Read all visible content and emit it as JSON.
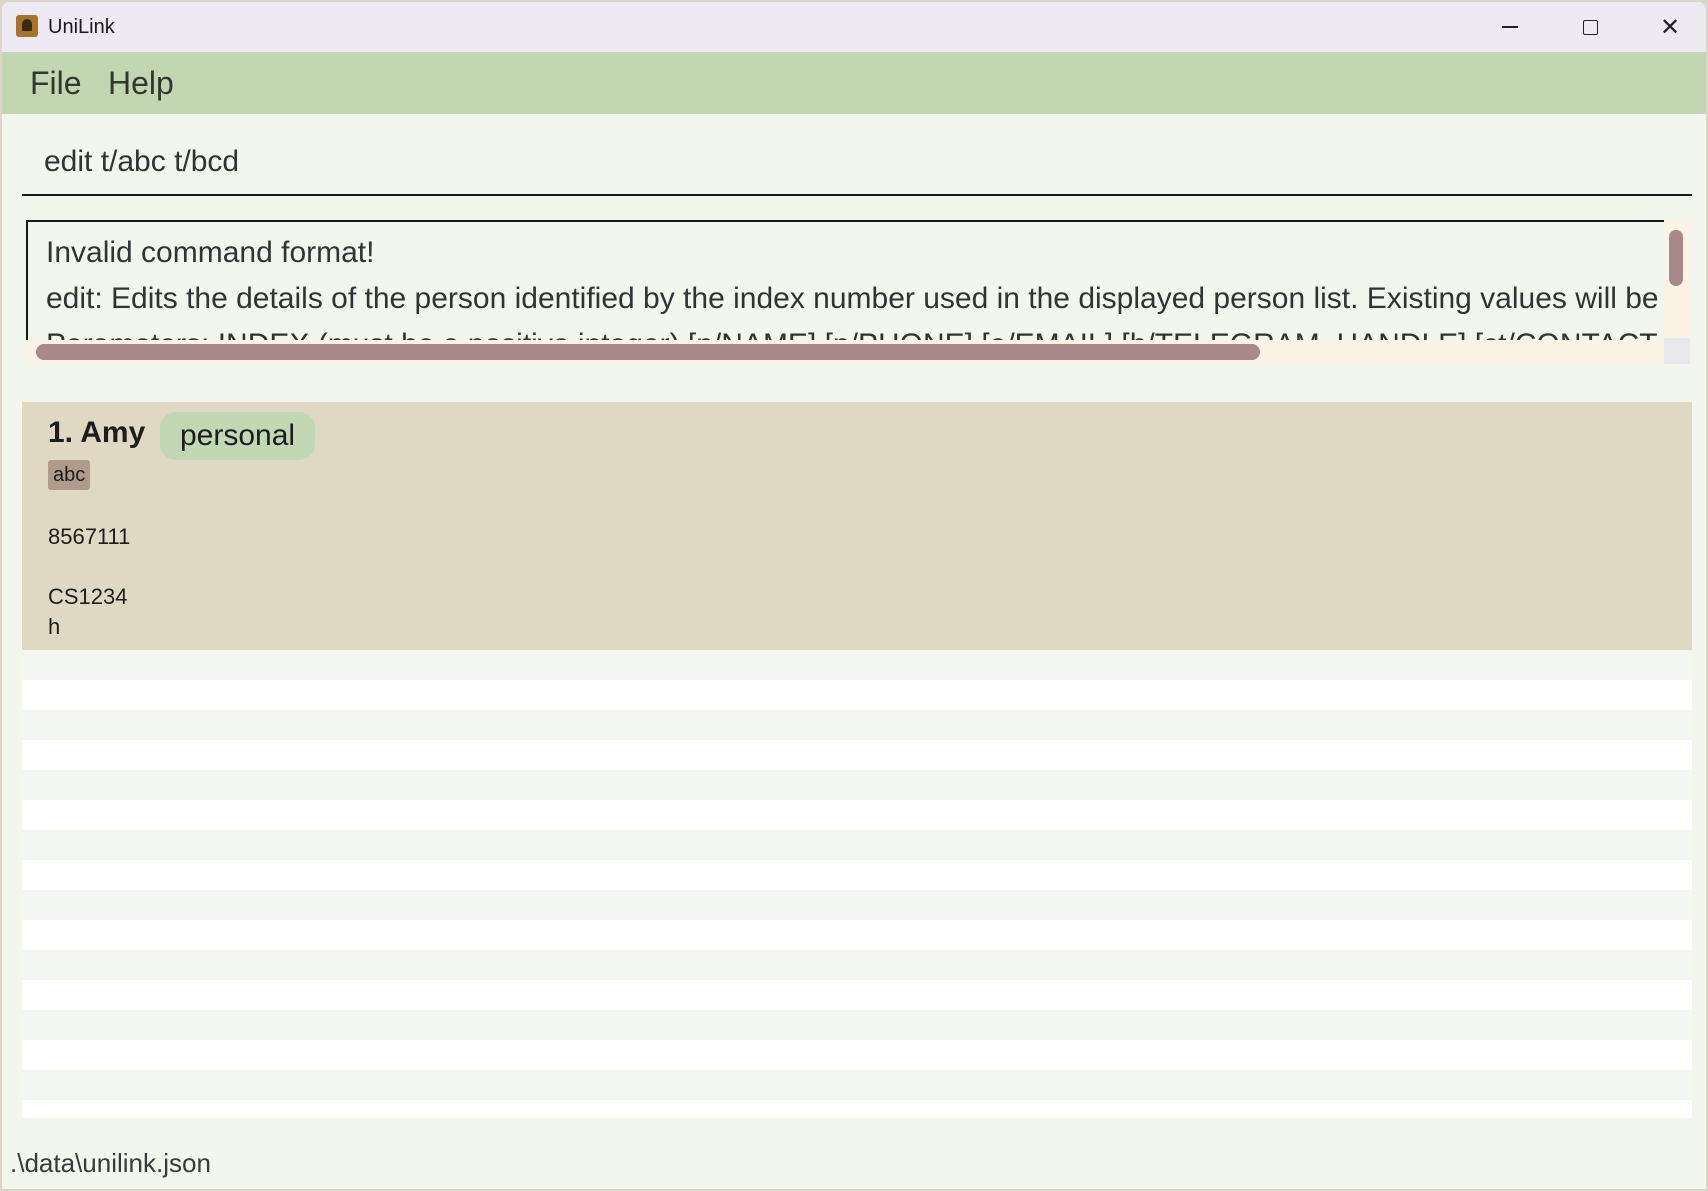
{
  "window": {
    "title": "UniLink",
    "icon": "address-book-icon"
  },
  "menu": {
    "file_label": "File",
    "help_label": "Help"
  },
  "command": {
    "value": "edit t/abc t/bcd"
  },
  "result": {
    "lines": [
      "Invalid command format!",
      "edit: Edits the details of the person identified by the index number used in the displayed person list. Existing values will be overwritten by the input values.",
      "Parameters: INDEX (must be a positive integer) [n/NAME] [p/PHONE] [e/EMAIL] [h/TELEGRAM_HANDLE] [ct/CONTACT_TYPE] [m/MODULE] [t/TAG]..."
    ]
  },
  "persons": [
    {
      "index_name": "1. Amy",
      "contact_type": "personal",
      "tags": [
        "abc"
      ],
      "phone": "8567111",
      "module": "CS1234",
      "handle": "h"
    }
  ],
  "status": {
    "path": ".\\data\\unilink.json"
  },
  "colors": {
    "menubar": "#c2d6b2",
    "card": "#dfd9c3",
    "contact_type_pill": "#c2d8b4",
    "tag": "#b09a8c",
    "scroll_thumb": "#a88888"
  }
}
